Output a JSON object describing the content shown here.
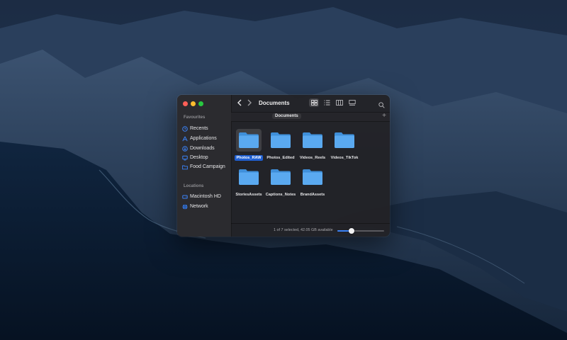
{
  "window": {
    "title": "Documents",
    "path_tab": "Documents"
  },
  "sidebar": {
    "favourites_heading": "Favourites",
    "favourites": [
      {
        "label": "Recents",
        "icon": "clock-icon"
      },
      {
        "label": "Applications",
        "icon": "applications-icon"
      },
      {
        "label": "Downloads",
        "icon": "download-icon"
      },
      {
        "label": "Desktop",
        "icon": "desktop-icon"
      },
      {
        "label": "Food Campaign",
        "icon": "folder-icon"
      }
    ],
    "locations_heading": "Locations",
    "locations": [
      {
        "label": "Macintosh HD",
        "icon": "disk-icon"
      },
      {
        "label": "Network",
        "icon": "globe-icon"
      }
    ]
  },
  "toolbar": {
    "icons": [
      "chevron-left-icon",
      "chevron-right-icon",
      "grid-view-icon",
      "list-view-icon",
      "column-view-icon",
      "gallery-view-icon",
      "search-icon"
    ]
  },
  "files": [
    {
      "name": "Photos_RAW",
      "selected": true
    },
    {
      "name": "Photos_Edited",
      "selected": false
    },
    {
      "name": "Videos_Reels",
      "selected": false
    },
    {
      "name": "Videos_TikTok",
      "selected": false
    },
    {
      "name": "StoriesAssets",
      "selected": false
    },
    {
      "name": "Captions_Notes",
      "selected": false
    },
    {
      "name": "BrandAssets",
      "selected": false
    }
  ],
  "status": {
    "text": "1 of 7 selected, 42.05 GB available",
    "icon_size_fraction": 0.3
  },
  "colors": {
    "accent": "#3b82f6",
    "folder": "#5aa9f0",
    "selection": "#1f5fd1"
  }
}
